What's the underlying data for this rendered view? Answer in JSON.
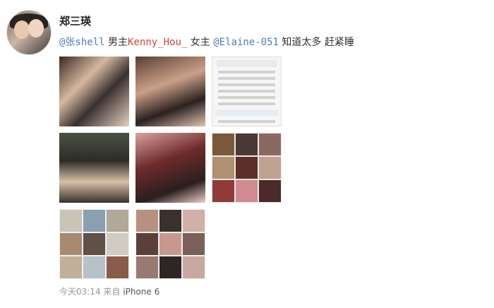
{
  "post": {
    "username": "郑三瑛",
    "text": {
      "mention1": "@张shell",
      "t1": " 男主",
      "mention2": "Kenny_Hou_",
      "t2": " 女主 ",
      "mention3": "@Elaine-051",
      "t3": " 知道太多 赶紧睡"
    },
    "footer": {
      "time": "今天03:14",
      "via": "来自",
      "device": "iPhone 6"
    }
  },
  "colors": {
    "mention": "#4a7dbf",
    "highlight_name": "#d0453a",
    "meta": "#999999"
  }
}
